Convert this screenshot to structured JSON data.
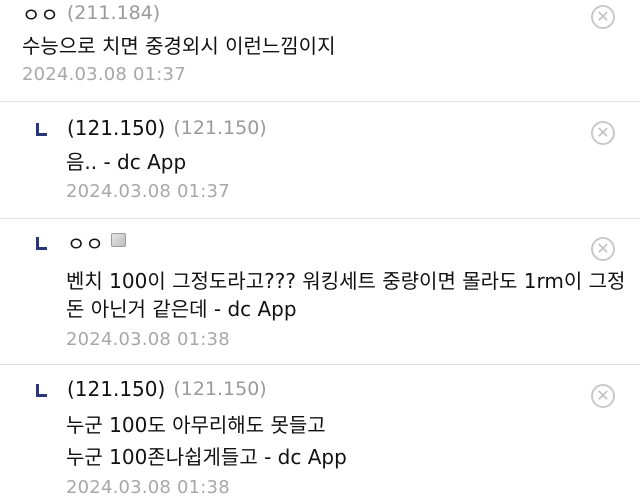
{
  "comments": [
    {
      "nick": "ㅇㅇ",
      "ip": "(211.184)",
      "text": "수능으로 치면 중경외시 이런느낌이지",
      "date": "2024.03.08 01:37"
    },
    {
      "nick": "(121.150)",
      "ip": "(121.150)",
      "text": "음.. - dc App",
      "date": "2024.03.08 01:37"
    },
    {
      "nick": "ㅇㅇ",
      "icon": "gallog-icon",
      "lines": [
        "벤치 100이 그정도라고??? 워킹세트 중량이면 몰라도 1rm이 그정",
        "돈 아닌거 같은데 - dc App"
      ],
      "date": "2024.03.08 01:38"
    },
    {
      "nick": "(121.150)",
      "ip": "(121.150)",
      "lines": [
        "누군 100도 아무리해도 못들고",
        "누군 100존나쉽게들고 - dc App"
      ],
      "date": "2024.03.08 01:38"
    }
  ],
  "delete_icon": "close-circle-icon",
  "delete_glyph": "✕",
  "reply_icon": "reply-arrow-icon",
  "colors": {
    "reply_marker": "#29367c",
    "meta_text": "#9a9a9a",
    "divider": "#e2e2e2"
  }
}
